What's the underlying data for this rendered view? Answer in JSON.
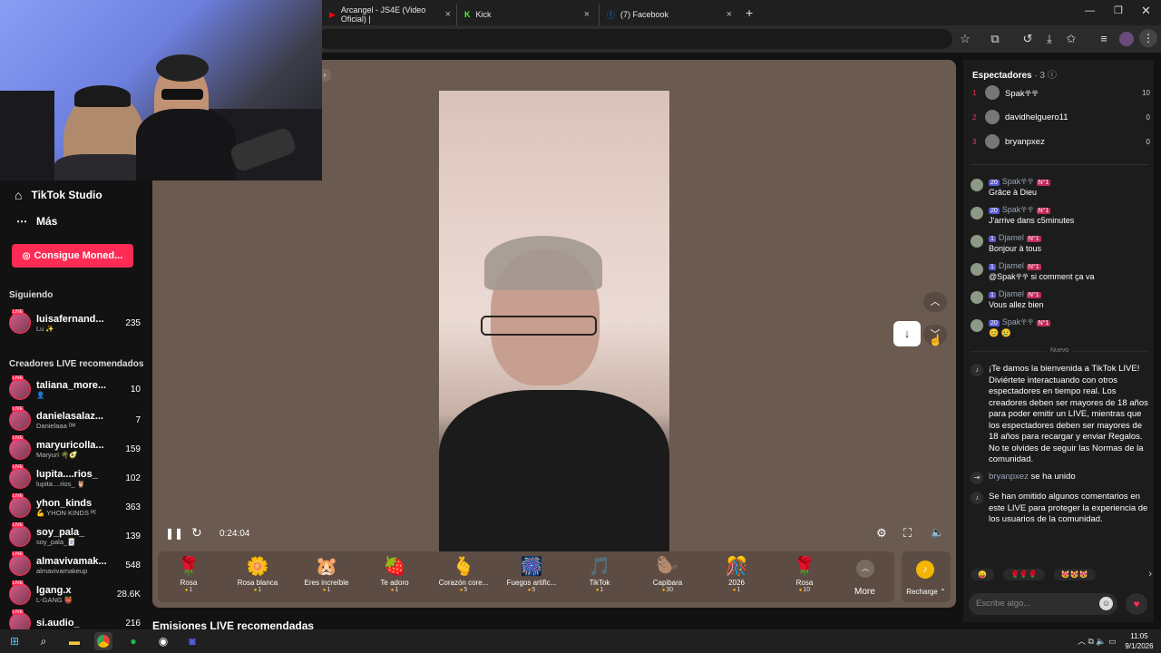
{
  "browser": {
    "tabs": [
      {
        "label": "Arcangel - JS4E (Video Oficial) |",
        "icon": "youtube-icon"
      },
      {
        "label": "Kick",
        "icon": "kick-icon"
      },
      {
        "label": "(7) Facebook",
        "icon": "facebook-icon"
      }
    ],
    "new_tab": "+",
    "close": "×"
  },
  "sidebar": {
    "studio": "TikTok Studio",
    "more": "Más",
    "coins_button": "Consigue Moned...",
    "following_title": "Siguiendo",
    "following": [
      {
        "name": "luisafernand...",
        "sub": "Lu ✨",
        "count": "235"
      }
    ],
    "recommended_title": "Creadores LIVE recomendados",
    "recommended": [
      {
        "name": "taliana_more...",
        "sub": "👤",
        "count": "10"
      },
      {
        "name": "danielasalaz...",
        "sub": "Danielaaa ᴰᴹ",
        "count": "7"
      },
      {
        "name": "maryuricolla...",
        "sub": "Maryuri 🌴🥑",
        "count": "159"
      },
      {
        "name": "lupita....rios_",
        "sub": "lupita....rios_ 🦉",
        "count": "102"
      },
      {
        "name": "yhon_kinds",
        "sub": "💪 YHON KINDS ᴾᴱ",
        "count": "363"
      },
      {
        "name": "soy_pala_",
        "sub": "soy_pala_🃏",
        "count": "139"
      },
      {
        "name": "almavivamak...",
        "sub": "almavivamakeup",
        "count": "548"
      },
      {
        "name": "lgang.x",
        "sub": "L-GANG 👹",
        "count": "28.6K"
      },
      {
        "name": "si.audio_",
        "sub": "",
        "count": "216"
      }
    ]
  },
  "player": {
    "time": "0:24:04",
    "recommended_heading": "Emisiones LIVE recomendadas"
  },
  "gifts": [
    {
      "name": "Rosa",
      "cost": "1",
      "icon": "🌹"
    },
    {
      "name": "Rosa blanca",
      "cost": "1",
      "icon": "🌼"
    },
    {
      "name": "Eres increíble",
      "cost": "1",
      "icon": "🐹"
    },
    {
      "name": "Te adoro",
      "cost": "1",
      "icon": "🍓"
    },
    {
      "name": "Corazón core...",
      "cost": "5",
      "icon": "🫰"
    },
    {
      "name": "Fuegos artific...",
      "cost": "5",
      "icon": "🎆"
    },
    {
      "name": "TikTok",
      "cost": "1",
      "icon": "🎵"
    },
    {
      "name": "Capibara",
      "cost": "30",
      "icon": "🦫"
    },
    {
      "name": "2026",
      "cost": "1",
      "icon": "🎊"
    },
    {
      "name": "Rosa",
      "cost": "10",
      "icon": "🌹"
    }
  ],
  "gift_more": "More",
  "recharge": "Recharge ⌃",
  "panel": {
    "viewers_title": "Espectadores",
    "viewers_count": "· 3",
    "viewers": [
      {
        "rank": "1",
        "name": "Spak𖣂𖣂",
        "count": "10"
      },
      {
        "rank": "2",
        "name": "davidhelguero11",
        "count": "0"
      },
      {
        "rank": "3",
        "name": "bryanpxez",
        "count": "0"
      }
    ],
    "comments": [
      {
        "level": "20",
        "user": "Spak𖣂𖣂",
        "badge": "N°1",
        "text": "Grâce à Dieu"
      },
      {
        "level": "20",
        "user": "Spak𖣂𖣂",
        "badge": "N°1",
        "text": "J'arrive dans c5minutes"
      },
      {
        "level": "1",
        "user": "Djamel",
        "badge": "N°1",
        "text": "Bonjour à tous"
      },
      {
        "level": "1",
        "user": "Djamel",
        "badge": "N°1",
        "text": "@Spak𖣂𖣂 si comment ça va"
      },
      {
        "level": "1",
        "user": "Djamel",
        "badge": "N°1",
        "text": "Vous allez bien"
      },
      {
        "level": "20",
        "user": "Spak𖣂𖣂",
        "badge": "N°1",
        "text": "😊 😢"
      }
    ],
    "new_divider": "Nuevo",
    "welcome": "¡Te damos la bienvenida a TikTok LIVE! Diviértete interactuando con otros espectadores en tiempo real. Los creadores deben ser mayores de 18 años para poder emitir un LIVE, mientras que los espectadores deben ser mayores de 18 años para recargar y enviar Regalos. No te olvides de seguir las Normas de la comunidad.",
    "joined_user": "bryanpxez",
    "joined_text": "se ha unido",
    "omitted": "Se han omitido algunos comentarios en este LIVE para proteger la experiencia de los usuarios de la comunidad.",
    "quick_emojis": [
      "😛",
      "🌹🌹🌹",
      "😻😻😻"
    ],
    "input_placeholder": "Escribe algo..."
  },
  "taskbar": {
    "time": "11:05",
    "date": "9/1/2026"
  }
}
